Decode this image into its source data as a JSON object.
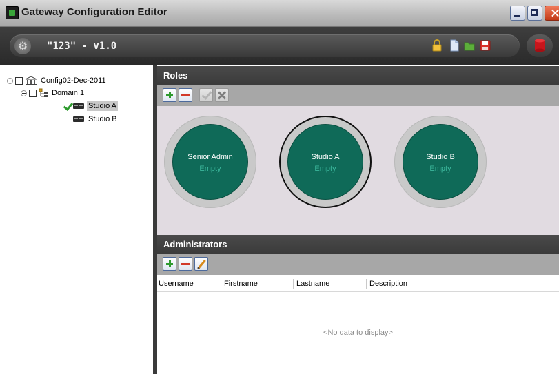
{
  "window": {
    "title": "Gateway Configuration Editor"
  },
  "toolbar": {
    "project_title": "\"123\" - v1.0",
    "icons": [
      "gear-icon",
      "lock-icon",
      "document-icon",
      "folder-icon",
      "save-icon",
      "database-icon"
    ]
  },
  "tree": {
    "root": {
      "label": "Config02-Dec-2011",
      "checked": false
    },
    "domain": {
      "label": "Domain 1",
      "checked": false
    },
    "items": [
      {
        "label": "Studio A",
        "checked": true,
        "selected": true
      },
      {
        "label": "Studio B",
        "checked": false,
        "selected": false
      }
    ]
  },
  "roles": {
    "header": "Roles",
    "list": [
      {
        "name": "Senior Admin",
        "status": "Empty"
      },
      {
        "name": "Studio A",
        "status": "Empty",
        "selected": true
      },
      {
        "name": "Studio B",
        "status": "Empty"
      }
    ]
  },
  "administrators": {
    "header": "Administrators",
    "columns": [
      "Username",
      "Firstname",
      "Lastname",
      "Description"
    ],
    "empty_text": "<No data to display>"
  },
  "colors": {
    "role_fill": "#0f6a58",
    "role_ring": "#c9c9c9",
    "header_bg": "#3a3a3a",
    "roles_area_bg": "#e1dbe1"
  }
}
